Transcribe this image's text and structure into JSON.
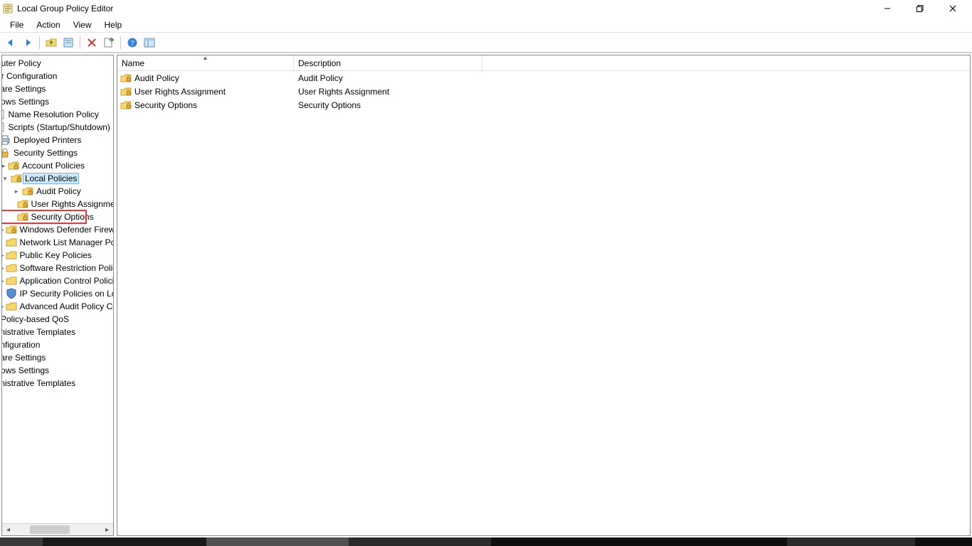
{
  "window": {
    "title": "Local Group Policy Editor"
  },
  "menus": [
    "File",
    "Action",
    "View",
    "Help"
  ],
  "toolbar_icons": [
    "back-icon",
    "forward-icon",
    "sep",
    "folder-up-icon",
    "properties-icon",
    "sep",
    "delete-icon",
    "export-icon",
    "sep",
    "help-icon",
    "show-hide-tree-icon"
  ],
  "tree": [
    {
      "indent": 0,
      "icon": "none",
      "label": "mputer Policy",
      "chev": "none"
    },
    {
      "indent": 0,
      "icon": "none",
      "label": "uter Configuration",
      "chev": "none"
    },
    {
      "indent": 0,
      "icon": "none",
      "label": "ftware Settings",
      "chev": "none"
    },
    {
      "indent": 0,
      "icon": "none",
      "label": "indows Settings",
      "chev": "none"
    },
    {
      "indent": 1,
      "icon": "doc",
      "label": "Name Resolution Policy",
      "chev": "none"
    },
    {
      "indent": 1,
      "icon": "doc",
      "label": "Scripts (Startup/Shutdown)",
      "chev": "none"
    },
    {
      "indent": 1,
      "icon": "printer",
      "label": "Deployed Printers",
      "chev": "none"
    },
    {
      "indent": 1,
      "icon": "lock",
      "label": "Security Settings",
      "chev": "none"
    },
    {
      "indent": 2,
      "icon": "folder-lock",
      "label": "Account Policies",
      "chev": "right"
    },
    {
      "indent": 2,
      "icon": "folder-lock",
      "label": "Local Policies",
      "chev": "down",
      "selected": true
    },
    {
      "indent": 3,
      "icon": "folder-lock",
      "label": "Audit Policy",
      "chev": "right"
    },
    {
      "indent": 3,
      "icon": "folder-lock",
      "label": "User Rights Assignment",
      "chev": "none"
    },
    {
      "indent": 3,
      "icon": "folder-lock",
      "label": "Security Options",
      "chev": "none",
      "highlighted": true
    },
    {
      "indent": 2,
      "icon": "folder-lock",
      "label": "Windows Defender Firewall with Advanced Security",
      "chev": "right"
    },
    {
      "indent": 2,
      "icon": "folder",
      "label": "Network List Manager Policies",
      "chev": "none"
    },
    {
      "indent": 2,
      "icon": "folder",
      "label": "Public Key Policies",
      "chev": "right"
    },
    {
      "indent": 2,
      "icon": "folder",
      "label": "Software Restriction Policies",
      "chev": "right"
    },
    {
      "indent": 2,
      "icon": "folder",
      "label": "Application Control Policies",
      "chev": "right"
    },
    {
      "indent": 2,
      "icon": "shield",
      "label": "IP Security Policies on Local Computer",
      "chev": "none"
    },
    {
      "indent": 2,
      "icon": "folder",
      "label": "Advanced Audit Policy Configuration",
      "chev": "right"
    },
    {
      "indent": 1,
      "icon": "none",
      "label": "Policy-based QoS",
      "chev": "none"
    },
    {
      "indent": 0,
      "icon": "none",
      "label": "lministrative Templates",
      "chev": "none"
    },
    {
      "indent": 0,
      "icon": "none",
      "label": "Configuration",
      "chev": "none"
    },
    {
      "indent": 0,
      "icon": "none",
      "label": "ftware Settings",
      "chev": "none"
    },
    {
      "indent": 0,
      "icon": "none",
      "label": "indows Settings",
      "chev": "none"
    },
    {
      "indent": 0,
      "icon": "none",
      "label": "lministrative Templates",
      "chev": "none"
    }
  ],
  "columns": {
    "name": "Name",
    "description": "Description"
  },
  "sorted_column": "name",
  "sort_direction": "asc",
  "items": [
    {
      "name": "Audit Policy",
      "desc": "Audit Policy"
    },
    {
      "name": "User Rights Assignment",
      "desc": "User Rights Assignment"
    },
    {
      "name": "Security Options",
      "desc": "Security Options"
    }
  ]
}
